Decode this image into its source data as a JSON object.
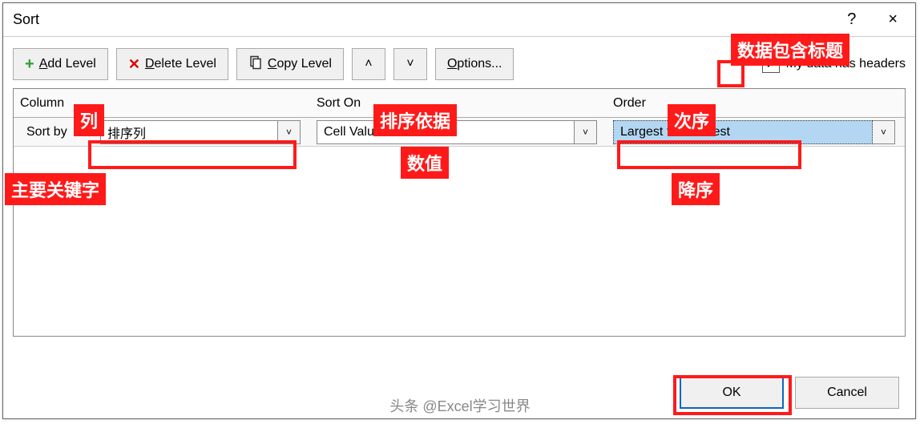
{
  "dialog": {
    "title": "Sort",
    "help": "?",
    "close": "×"
  },
  "toolbar": {
    "add_label": "Add Level",
    "delete_label": "Delete Level",
    "copy_label": "Copy Level",
    "move_up": "˄",
    "move_down": "˅",
    "options_label": "Options...",
    "headers_label": "My data has headers",
    "headers_checked": "✓"
  },
  "grid": {
    "head_column": "Column",
    "head_sorton": "Sort On",
    "head_order": "Order",
    "row_label": "Sort by",
    "row_column_value": "排序列",
    "row_sorton_value": "Cell Values",
    "row_order_value": "Largest to Smallest"
  },
  "footer": {
    "ok": "OK",
    "cancel": "Cancel"
  },
  "annotations": {
    "headers": "数据包含标题",
    "column": "列",
    "sorton": "排序依据",
    "order": "次序",
    "sortby": "主要关键字",
    "cellvalues": "数值",
    "largest": "降序"
  },
  "watermark": "头条 @Excel学习世界"
}
